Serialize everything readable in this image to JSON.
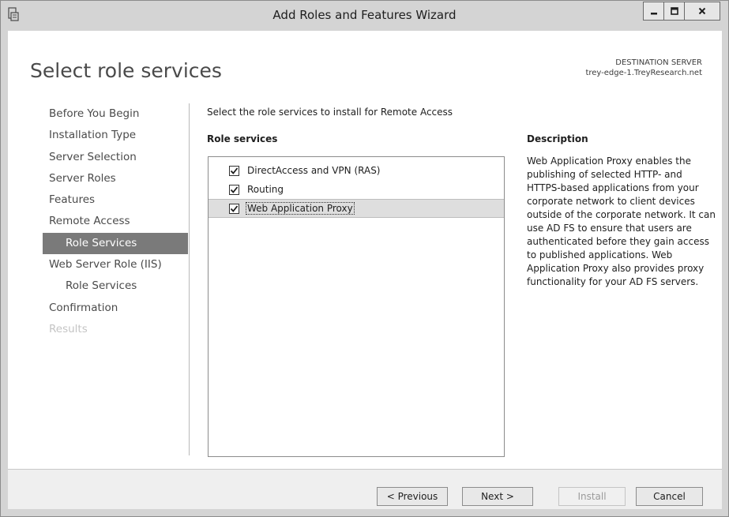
{
  "window": {
    "title": "Add Roles and Features Wizard",
    "icon": "server-manager-icon",
    "controls": [
      "minimize-icon",
      "maximize-icon",
      "close-icon"
    ]
  },
  "header": {
    "page_title": "Select role services",
    "destination_label": "DESTINATION SERVER",
    "destination_server": "trey-edge-1.TreyResearch.net"
  },
  "nav": {
    "items": [
      {
        "label": "Before You Begin",
        "state": "normal"
      },
      {
        "label": "Installation Type",
        "state": "normal"
      },
      {
        "label": "Server Selection",
        "state": "normal"
      },
      {
        "label": "Server Roles",
        "state": "normal"
      },
      {
        "label": "Features",
        "state": "normal"
      },
      {
        "label": "Remote Access",
        "state": "normal"
      },
      {
        "label": "Role Services",
        "state": "active"
      },
      {
        "label": "Web Server Role (IIS)",
        "state": "normal"
      },
      {
        "label": "Role Services",
        "state": "normal"
      },
      {
        "label": "Confirmation",
        "state": "normal"
      },
      {
        "label": "Results",
        "state": "disabled"
      }
    ]
  },
  "main": {
    "instruction": "Select the role services to install for Remote Access",
    "list_heading": "Role services",
    "role_services": [
      {
        "label": "DirectAccess and VPN (RAS)",
        "checked": true,
        "selected": false
      },
      {
        "label": "Routing",
        "checked": true,
        "selected": false
      },
      {
        "label": "Web Application Proxy",
        "checked": true,
        "selected": true
      }
    ]
  },
  "description": {
    "heading": "Description",
    "text": "Web Application Proxy enables the publishing of selected HTTP- and HTTPS-based applications from your corporate network to client devices outside of the corporate network. It can use AD FS to ensure that users are authenticated before they gain access to published applications. Web Application Proxy also provides proxy functionality for your AD FS servers."
  },
  "footer": {
    "previous_label": "< Previous",
    "next_label": "Next >",
    "install_label": "Install",
    "cancel_label": "Cancel"
  },
  "colors": {
    "active_nav_bg": "#7a7a7a",
    "selected_row_bg": "#dedede",
    "chrome_bg": "#d4d4d4"
  }
}
